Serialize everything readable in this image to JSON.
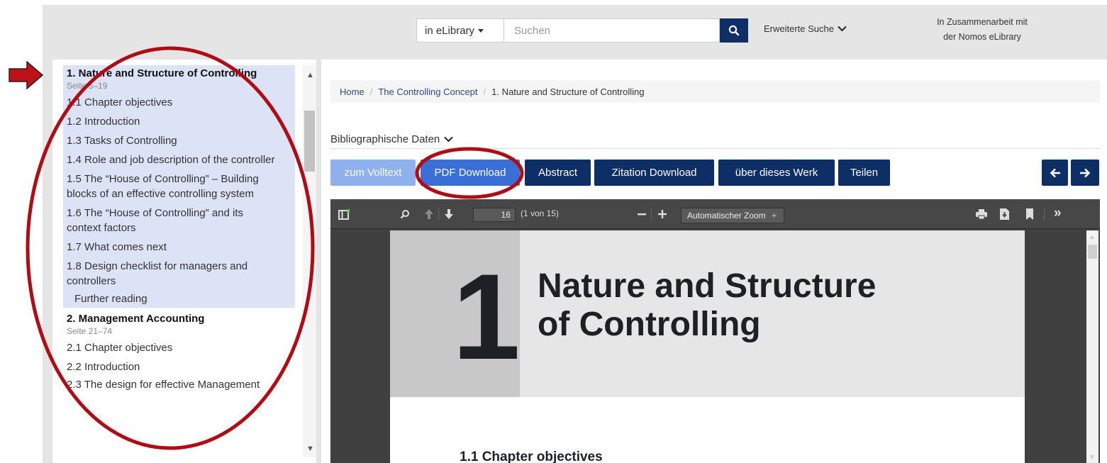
{
  "header": {
    "scope_label": "in eLibrary",
    "search_placeholder": "Suchen",
    "advanced_search": "Erweiterte Suche",
    "partner_line1": "In Zusammenarbeit mit",
    "partner_line2": "der Nomos eLibrary"
  },
  "toc": {
    "chapter1": {
      "title": "1. Nature and Structure of Controlling",
      "pages": "Seite 5–19",
      "items": [
        "1.1 Chapter objectives",
        "1.2 Introduction",
        "1.3 Tasks of Controlling",
        "1.4 Role and job description of the controller",
        "1.5 The “House of Controlling” – Building blocks of an effective controlling system",
        "1.6 The “House of Controlling” and its context factors",
        "1.7 What comes next",
        "1.8 Design checklist for managers and controllers"
      ],
      "further_reading": "Further reading"
    },
    "chapter2": {
      "title": "2. Management Accounting",
      "pages": "Seite 21–74",
      "items": [
        "2.1 Chapter objectives",
        "2.2 Introduction",
        "2.3 The design for effective Management"
      ]
    }
  },
  "breadcrumb": {
    "home": "Home",
    "parent": "The Controlling Concept",
    "current": "1. Nature and Structure of Controlling"
  },
  "biblio_label": "Bibliographische Daten",
  "actions": {
    "volltext": "zum Volltext",
    "pdf_download": "PDF Download",
    "abstract": "Abstract",
    "citation": "Zitation Download",
    "about": "über dieses Werk",
    "share": "Teilen"
  },
  "viewer": {
    "page_number": "16",
    "page_count": "(1 von 15)",
    "zoom": "Automatischer Zoom"
  },
  "pdf_page": {
    "chapter_number": "1",
    "title_line1": "Nature and Structure",
    "title_line2": "of Controlling",
    "section_heading": "1.1  Chapter objectives"
  },
  "colors": {
    "navy": "#0e2f66",
    "toc_highlight": "#dde3f6",
    "annotation_red": "#b00c14"
  }
}
